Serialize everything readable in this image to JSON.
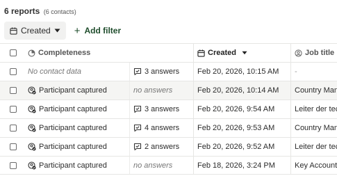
{
  "header": {
    "count_label": "6 reports",
    "sub_label": "(6 contacts)"
  },
  "toolbar": {
    "created_label": "Created",
    "add_filter_label": "Add filter"
  },
  "columns": {
    "completeness": "Completeness",
    "created": "Created",
    "job_title": "Job title"
  },
  "rows": [
    {
      "completeness": "No contact data",
      "answers": "3 answers",
      "created": "Feb 20, 2026, 10:15 AM",
      "job_title": "-"
    },
    {
      "completeness": "Participant captured",
      "answers": "no answers",
      "created": "Feb 20, 2026, 10:14 AM",
      "job_title": "Country Mana"
    },
    {
      "completeness": "Participant captured",
      "answers": "3 answers",
      "created": "Feb 20, 2026, 9:54 AM",
      "job_title": "Leiter der tec"
    },
    {
      "completeness": "Participant captured",
      "answers": "4 answers",
      "created": "Feb 20, 2026, 9:53 AM",
      "job_title": "Country Mana"
    },
    {
      "completeness": "Participant captured",
      "answers": "2 answers",
      "created": "Feb 20, 2026, 9:52 AM",
      "job_title": "Leiter der tec"
    },
    {
      "completeness": "Participant captured",
      "answers": "no answers",
      "created": "Feb 18, 2026, 3:24 PM",
      "job_title": "Key Account"
    }
  ]
}
